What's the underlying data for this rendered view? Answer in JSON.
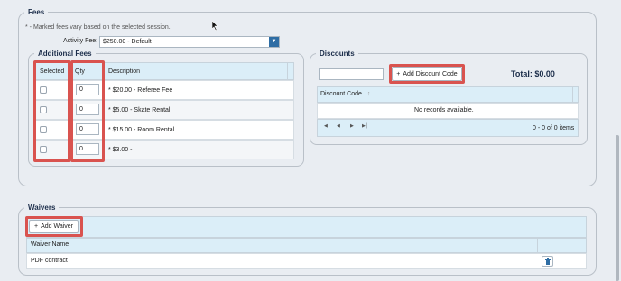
{
  "fees": {
    "legend": "Fees",
    "note": "* - Marked fees vary based on the selected session.",
    "activity_fee_label": "Activity Fee:",
    "activity_fee_value": "$250.00 - Default",
    "additional_fees": {
      "legend": "Additional Fees",
      "columns": [
        "Selected",
        "Qty",
        "Description"
      ],
      "rows": [
        {
          "qty": "0",
          "description": "* $20.00 - Referee Fee"
        },
        {
          "qty": "0",
          "description": "* $5.00 - Skate Rental"
        },
        {
          "qty": "0",
          "description": "* $15.00 - Room Rental"
        },
        {
          "qty": "0",
          "description": "* $3.00 -"
        }
      ]
    },
    "discounts": {
      "legend": "Discounts",
      "code_input_value": "",
      "add_button": "Add Discount Code",
      "total": "Total: $0.00",
      "column": "Discount Code",
      "empty_message": "No records available.",
      "pager_summary": "0 - 0 of 0 items"
    }
  },
  "waivers": {
    "legend": "Waivers",
    "add_button": "Add Waiver",
    "column": "Waiver Name",
    "rows": [
      {
        "name": "PDF contract"
      }
    ]
  },
  "colors": {
    "highlight": "#d9534f",
    "grid_header": "#dbeef8",
    "title": "#1b2d4a"
  },
  "icons": {
    "dropdown": "chevron-down-icon",
    "add": "plus-icon",
    "delete": "trash-icon",
    "pager": [
      "first-page-icon",
      "prev-page-icon",
      "next-page-icon",
      "last-page-icon"
    ]
  }
}
